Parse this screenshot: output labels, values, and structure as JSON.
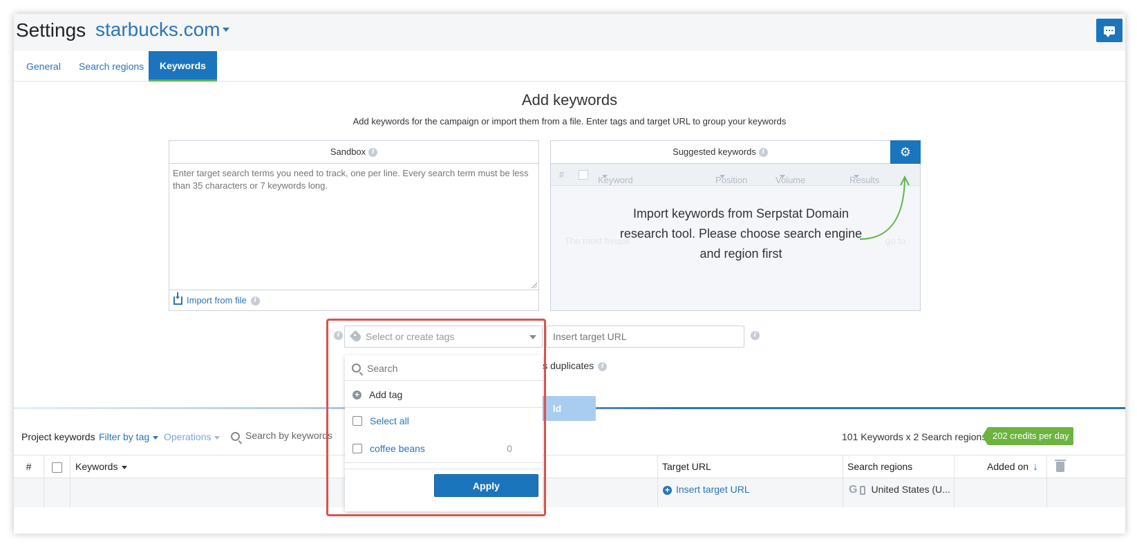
{
  "header": {
    "title": "Settings",
    "domain": "starbucks.com"
  },
  "tabs": [
    {
      "label": "General",
      "active": false
    },
    {
      "label": "Search regions",
      "active": false
    },
    {
      "label": "Keywords",
      "active": true
    }
  ],
  "add_keywords": {
    "title": "Add keywords",
    "subtitle": "Add keywords for the campaign or import them from a file. Enter tags and target URL to group your keywords"
  },
  "sandbox": {
    "title": "Sandbox",
    "placeholder": "Enter target search terms you need to track, one per line. Every search term must be less than 35 characters or 7 keywords long.",
    "import_label": "Import from file"
  },
  "suggested": {
    "title": "Suggested keywords",
    "columns": [
      "#",
      "Keyword",
      "Position",
      "Volume",
      "Results"
    ],
    "faded_left": "The most freque",
    "faded_right": "go to",
    "message": "Import keywords from Serpstat Domain research tool. Please choose search engine and region first"
  },
  "tags": {
    "placeholder": "Select or create tags"
  },
  "target_url": {
    "placeholder": "Insert target URL"
  },
  "duplicates_text": "ords duplicates",
  "add_button_label": "ld",
  "dropdown": {
    "search_placeholder": "Search",
    "add_tag_label": "Add tag",
    "select_all_label": "Select all",
    "items": [
      {
        "label": "coffee beans",
        "count": "0"
      }
    ],
    "apply_label": "Apply"
  },
  "project_keywords": {
    "label": "Project keywords",
    "filter_label": "Filter by tag",
    "operations_label": "Operations",
    "search_placeholder": "Search by keywords",
    "credits_text": "101 Keywords x 2 Search regions =",
    "credits_badge": "202 credits per day"
  },
  "table": {
    "headers": {
      "num": "#",
      "keywords": "Keywords",
      "target_url": "Target URL",
      "search_regions": "Search regions",
      "added_on": "Added on"
    },
    "row": {
      "target_url_link": "Insert target URL",
      "region": "United States (U..."
    }
  },
  "colors": {
    "primary": "#1b75bc",
    "link": "#2a75b8",
    "accent_green": "#6cb33f",
    "highlight_red": "#d9534f"
  }
}
